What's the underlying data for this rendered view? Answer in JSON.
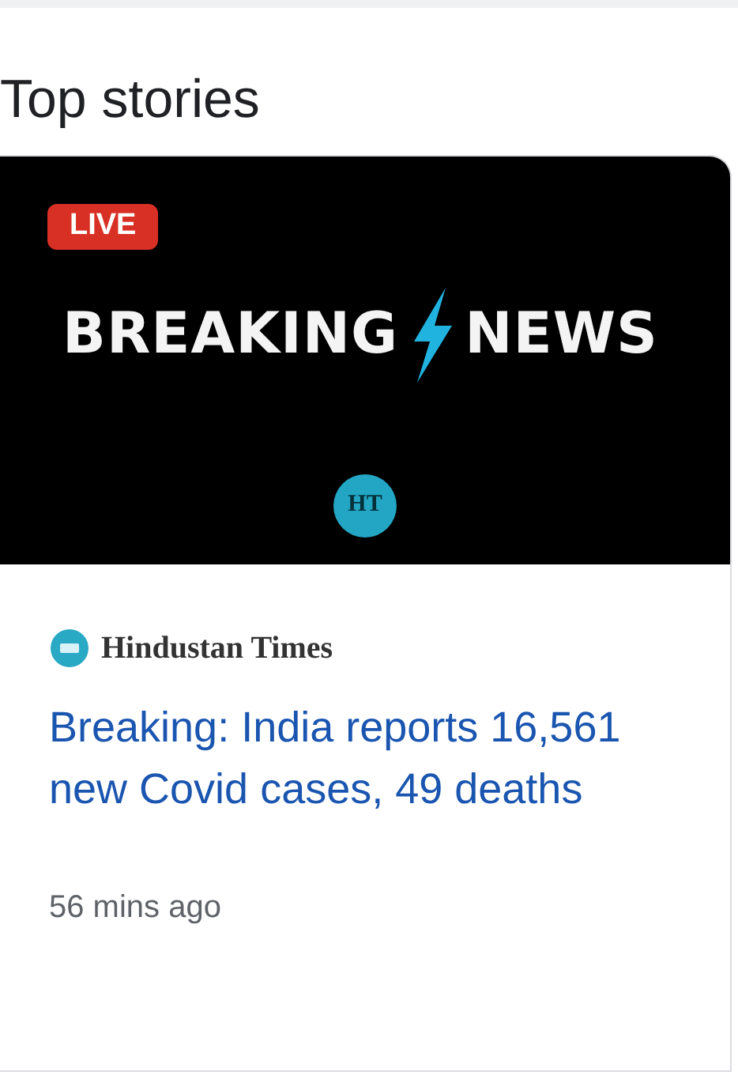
{
  "section_title": "Top stories",
  "story": {
    "thumbnail": {
      "badge": "LIVE",
      "headline_left": "BREAKING",
      "headline_right": "NEWS",
      "logo_text": "HT"
    },
    "publisher": "Hindustan Times",
    "headline": "Breaking: India reports 16,561 new Covid cases, 49 deaths",
    "time": "56 mins ago"
  }
}
